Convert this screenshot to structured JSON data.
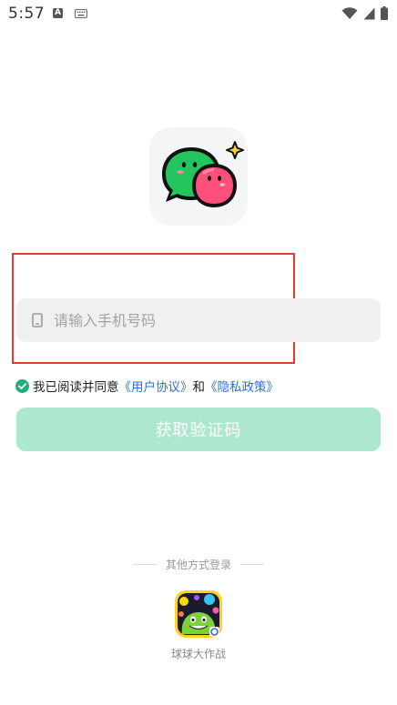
{
  "status_bar": {
    "time": "5:57",
    "a_badge": "A"
  },
  "login": {
    "phone_placeholder": "请输入手机号码",
    "phone_value": "",
    "agree_text": "我已阅读并同意",
    "user_agreement": "《用户协议》",
    "and_text": "和",
    "privacy_policy": "《隐私政策》",
    "get_code_label": "获取验证码"
  },
  "other_login": {
    "title": "其他方式登录",
    "game_name": "球球大作战"
  },
  "colors": {
    "primary_disabled": "#abe8ce",
    "link": "#2f6fce",
    "check": "#1fb07a",
    "highlight": "#e53935"
  }
}
